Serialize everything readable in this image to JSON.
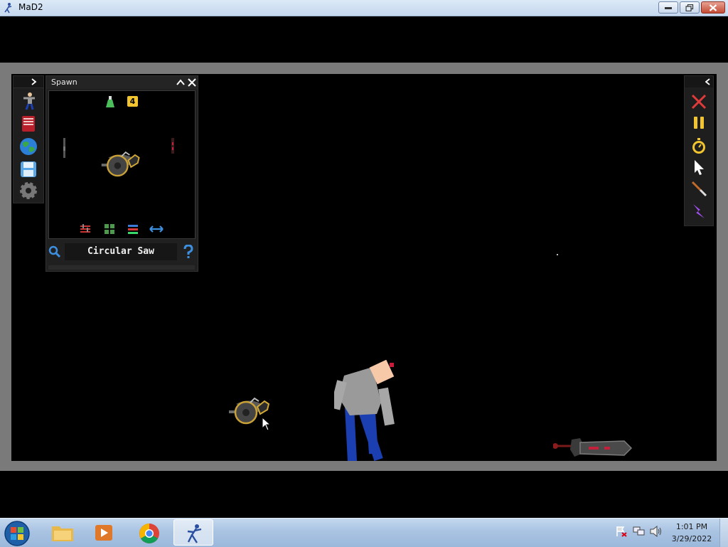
{
  "window": {
    "title": "MaD2"
  },
  "spawn_panel": {
    "title": "Spawn",
    "count_badge": "4",
    "selected_item": "Circular Saw"
  },
  "taskbar": {
    "clock_time": "1:01 PM",
    "clock_date": "3/29/2022",
    "pinned": [
      "windows-explorer",
      "media-player",
      "chrome",
      "mad2"
    ]
  },
  "colors": {
    "accent": "#f2c530",
    "close_red": "#e03a3a",
    "search_blue": "#3d8fe0"
  }
}
